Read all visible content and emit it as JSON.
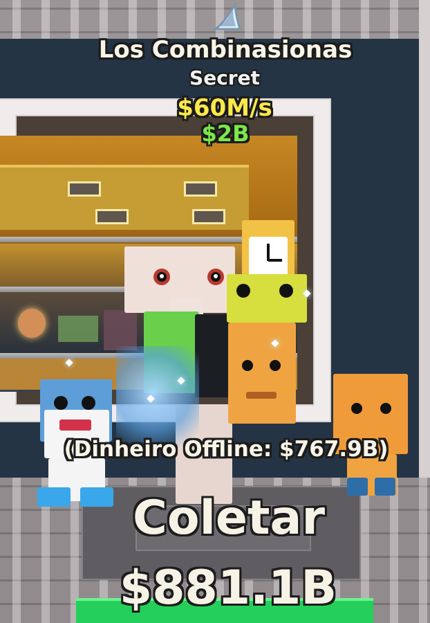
{
  "brainrot": {
    "name": "Los Combinasionas",
    "rarity": "Secret",
    "income": "$60M/s",
    "price": "$2B"
  },
  "offline": {
    "text": "(Dinheiro Offline: $767.9B)"
  },
  "collect": {
    "label": "Coletar",
    "amount": "$881.1B"
  },
  "icons": {
    "rarity": "shark-fin-icon"
  },
  "colors": {
    "secret_text": "#f1f1f1",
    "income_text": "#ffe94a",
    "price_text": "#7be84a",
    "collect_text": "#f7f2e6",
    "green_pad": "#24d05b"
  }
}
